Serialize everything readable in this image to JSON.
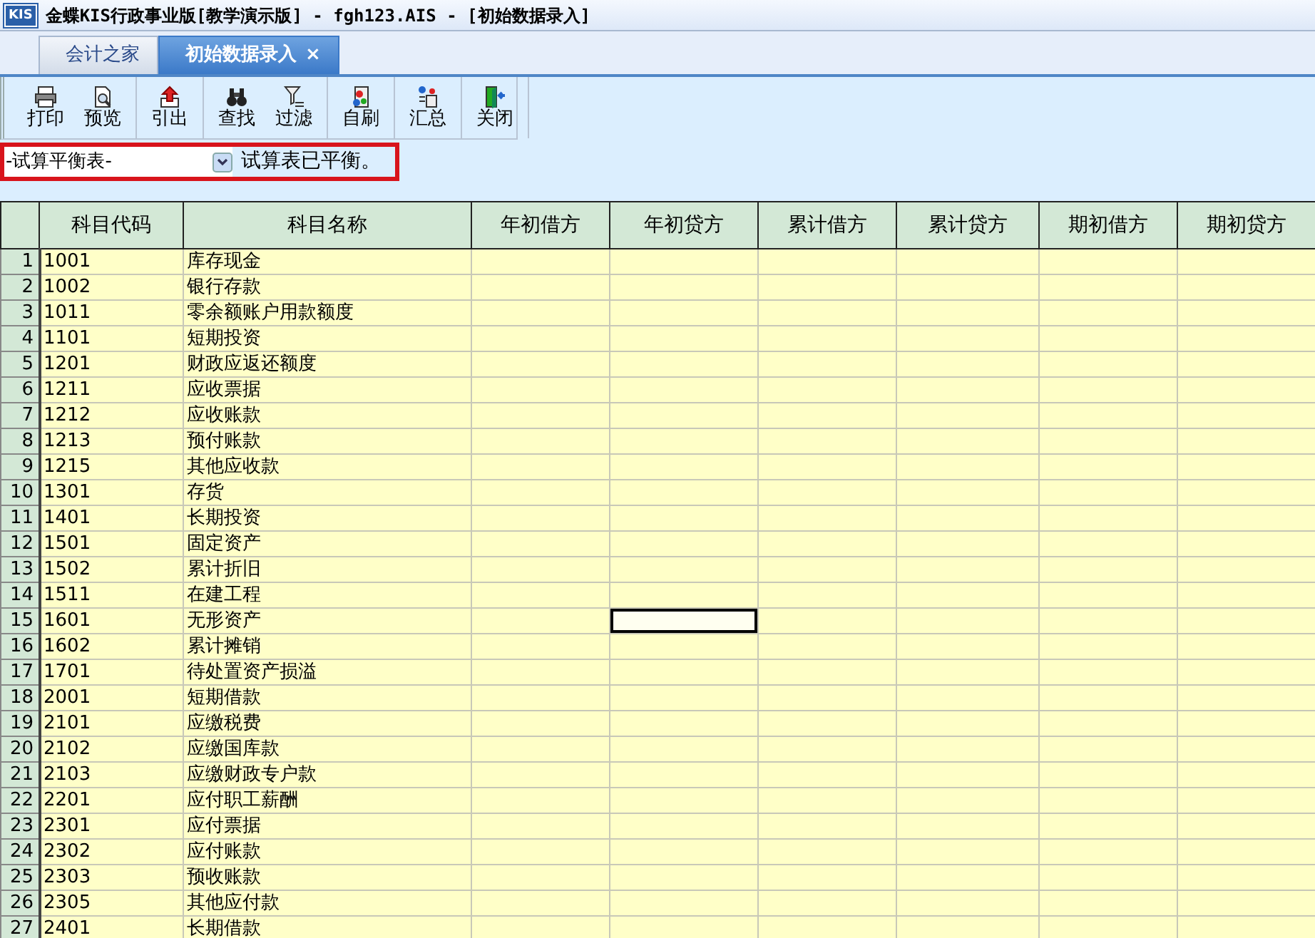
{
  "window": {
    "logo_text": "KIS",
    "title": "金蝶KIS行政事业版[教学演示版] - fgh123.AIS - [初始数据录入]"
  },
  "tabs": [
    {
      "label": "会计之家",
      "selected": false,
      "closable": false
    },
    {
      "label": "初始数据录入",
      "selected": true,
      "closable": true,
      "close_glyph": "×"
    }
  ],
  "toolbar": {
    "groups": [
      [
        {
          "label": "打印",
          "kind": "print"
        },
        {
          "label": "预览",
          "kind": "preview"
        }
      ],
      [
        {
          "label": "引出",
          "kind": "export"
        }
      ],
      [
        {
          "label": "查找",
          "kind": "find"
        },
        {
          "label": "过滤",
          "kind": "filter"
        }
      ],
      [
        {
          "label": "自刷",
          "kind": "refresh"
        }
      ],
      [
        {
          "label": "汇总",
          "kind": "summary"
        }
      ],
      [
        {
          "label": "关闭",
          "kind": "close"
        }
      ]
    ]
  },
  "filter_bar": {
    "dropdown_value": "-试算平衡表-",
    "status": "试算表已平衡。"
  },
  "table": {
    "columns": [
      "科目代码",
      "科目名称",
      "年初借方",
      "年初贷方",
      "累计借方",
      "累计贷方",
      "期初借方",
      "期初贷方"
    ],
    "rows": [
      {
        "number": "1",
        "code": "1001",
        "name": "库存现金",
        "cells": [
          {
            "focused": false
          },
          {
            "focused": false
          },
          {
            "focused": false
          },
          {
            "focused": false
          },
          {
            "focused": false
          },
          {
            "focused": false
          }
        ]
      },
      {
        "number": "2",
        "code": "1002",
        "name": "银行存款",
        "cells": [
          {
            "focused": false
          },
          {
            "focused": false
          },
          {
            "focused": false
          },
          {
            "focused": false
          },
          {
            "focused": false
          },
          {
            "focused": false
          }
        ]
      },
      {
        "number": "3",
        "code": "1011",
        "name": "零余额账户用款额度",
        "cells": [
          {
            "focused": false
          },
          {
            "focused": false
          },
          {
            "focused": false
          },
          {
            "focused": false
          },
          {
            "focused": false
          },
          {
            "focused": false
          }
        ]
      },
      {
        "number": "4",
        "code": "1101",
        "name": "短期投资",
        "cells": [
          {
            "focused": false
          },
          {
            "focused": false
          },
          {
            "focused": false
          },
          {
            "focused": false
          },
          {
            "focused": false
          },
          {
            "focused": false
          }
        ]
      },
      {
        "number": "5",
        "code": "1201",
        "name": "财政应返还额度",
        "cells": [
          {
            "focused": false
          },
          {
            "focused": false
          },
          {
            "focused": false
          },
          {
            "focused": false
          },
          {
            "focused": false
          },
          {
            "focused": false
          }
        ]
      },
      {
        "number": "6",
        "code": "1211",
        "name": "应收票据",
        "cells": [
          {
            "focused": false
          },
          {
            "focused": false
          },
          {
            "focused": false
          },
          {
            "focused": false
          },
          {
            "focused": false
          },
          {
            "focused": false
          }
        ]
      },
      {
        "number": "7",
        "code": "1212",
        "name": "应收账款",
        "cells": [
          {
            "focused": false
          },
          {
            "focused": false
          },
          {
            "focused": false
          },
          {
            "focused": false
          },
          {
            "focused": false
          },
          {
            "focused": false
          }
        ]
      },
      {
        "number": "8",
        "code": "1213",
        "name": "预付账款",
        "cells": [
          {
            "focused": false
          },
          {
            "focused": false
          },
          {
            "focused": false
          },
          {
            "focused": false
          },
          {
            "focused": false
          },
          {
            "focused": false
          }
        ]
      },
      {
        "number": "9",
        "code": "1215",
        "name": "其他应收款",
        "cells": [
          {
            "focused": false
          },
          {
            "focused": false
          },
          {
            "focused": false
          },
          {
            "focused": false
          },
          {
            "focused": false
          },
          {
            "focused": false
          }
        ]
      },
      {
        "number": "10",
        "code": "1301",
        "name": "存货",
        "cells": [
          {
            "focused": false
          },
          {
            "focused": false
          },
          {
            "focused": false
          },
          {
            "focused": false
          },
          {
            "focused": false
          },
          {
            "focused": false
          }
        ]
      },
      {
        "number": "11",
        "code": "1401",
        "name": "长期投资",
        "cells": [
          {
            "focused": false
          },
          {
            "focused": false
          },
          {
            "focused": false
          },
          {
            "focused": false
          },
          {
            "focused": false
          },
          {
            "focused": false
          }
        ]
      },
      {
        "number": "12",
        "code": "1501",
        "name": "固定资产",
        "cells": [
          {
            "focused": false
          },
          {
            "focused": false
          },
          {
            "focused": false
          },
          {
            "focused": false
          },
          {
            "focused": false
          },
          {
            "focused": false
          }
        ]
      },
      {
        "number": "13",
        "code": "1502",
        "name": "累计折旧",
        "cells": [
          {
            "focused": false
          },
          {
            "focused": false
          },
          {
            "focused": false
          },
          {
            "focused": false
          },
          {
            "focused": false
          },
          {
            "focused": false
          }
        ]
      },
      {
        "number": "14",
        "code": "1511",
        "name": "在建工程",
        "cells": [
          {
            "focused": false
          },
          {
            "focused": false
          },
          {
            "focused": false
          },
          {
            "focused": false
          },
          {
            "focused": false
          },
          {
            "focused": false
          }
        ]
      },
      {
        "number": "15",
        "code": "1601",
        "name": "无形资产",
        "cells": [
          {
            "focused": false
          },
          {
            "focused": true
          },
          {
            "focused": false
          },
          {
            "focused": false
          },
          {
            "focused": false
          },
          {
            "focused": false
          }
        ]
      },
      {
        "number": "16",
        "code": "1602",
        "name": "累计摊销",
        "cells": [
          {
            "focused": false
          },
          {
            "focused": false
          },
          {
            "focused": false
          },
          {
            "focused": false
          },
          {
            "focused": false
          },
          {
            "focused": false
          }
        ]
      },
      {
        "number": "17",
        "code": "1701",
        "name": "待处置资产损溢",
        "cells": [
          {
            "focused": false
          },
          {
            "focused": false
          },
          {
            "focused": false
          },
          {
            "focused": false
          },
          {
            "focused": false
          },
          {
            "focused": false
          }
        ]
      },
      {
        "number": "18",
        "code": "2001",
        "name": "短期借款",
        "cells": [
          {
            "focused": false
          },
          {
            "focused": false
          },
          {
            "focused": false
          },
          {
            "focused": false
          },
          {
            "focused": false
          },
          {
            "focused": false
          }
        ]
      },
      {
        "number": "19",
        "code": "2101",
        "name": "应缴税费",
        "cells": [
          {
            "focused": false
          },
          {
            "focused": false
          },
          {
            "focused": false
          },
          {
            "focused": false
          },
          {
            "focused": false
          },
          {
            "focused": false
          }
        ]
      },
      {
        "number": "20",
        "code": "2102",
        "name": "应缴国库款",
        "cells": [
          {
            "focused": false
          },
          {
            "focused": false
          },
          {
            "focused": false
          },
          {
            "focused": false
          },
          {
            "focused": false
          },
          {
            "focused": false
          }
        ]
      },
      {
        "number": "21",
        "code": "2103",
        "name": "应缴财政专户款",
        "cells": [
          {
            "focused": false
          },
          {
            "focused": false
          },
          {
            "focused": false
          },
          {
            "focused": false
          },
          {
            "focused": false
          },
          {
            "focused": false
          }
        ]
      },
      {
        "number": "22",
        "code": "2201",
        "name": "应付职工薪酬",
        "cells": [
          {
            "focused": false
          },
          {
            "focused": false
          },
          {
            "focused": false
          },
          {
            "focused": false
          },
          {
            "focused": false
          },
          {
            "focused": false
          }
        ]
      },
      {
        "number": "23",
        "code": "2301",
        "name": "应付票据",
        "cells": [
          {
            "focused": false
          },
          {
            "focused": false
          },
          {
            "focused": false
          },
          {
            "focused": false
          },
          {
            "focused": false
          },
          {
            "focused": false
          }
        ]
      },
      {
        "number": "24",
        "code": "2302",
        "name": "应付账款",
        "cells": [
          {
            "focused": false
          },
          {
            "focused": false
          },
          {
            "focused": false
          },
          {
            "focused": false
          },
          {
            "focused": false
          },
          {
            "focused": false
          }
        ]
      },
      {
        "number": "25",
        "code": "2303",
        "name": "预收账款",
        "cells": [
          {
            "focused": false
          },
          {
            "focused": false
          },
          {
            "focused": false
          },
          {
            "focused": false
          },
          {
            "focused": false
          },
          {
            "focused": false
          }
        ]
      },
      {
        "number": "26",
        "code": "2305",
        "name": "其他应付款",
        "cells": [
          {
            "focused": false
          },
          {
            "focused": false
          },
          {
            "focused": false
          },
          {
            "focused": false
          },
          {
            "focused": false
          },
          {
            "focused": false
          }
        ]
      },
      {
        "number": "27",
        "code": "2401",
        "name": "长期借款",
        "cells": [
          {
            "focused": false
          },
          {
            "focused": false
          },
          {
            "focused": false
          },
          {
            "focused": false
          },
          {
            "focused": false
          },
          {
            "focused": false
          }
        ]
      }
    ]
  }
}
